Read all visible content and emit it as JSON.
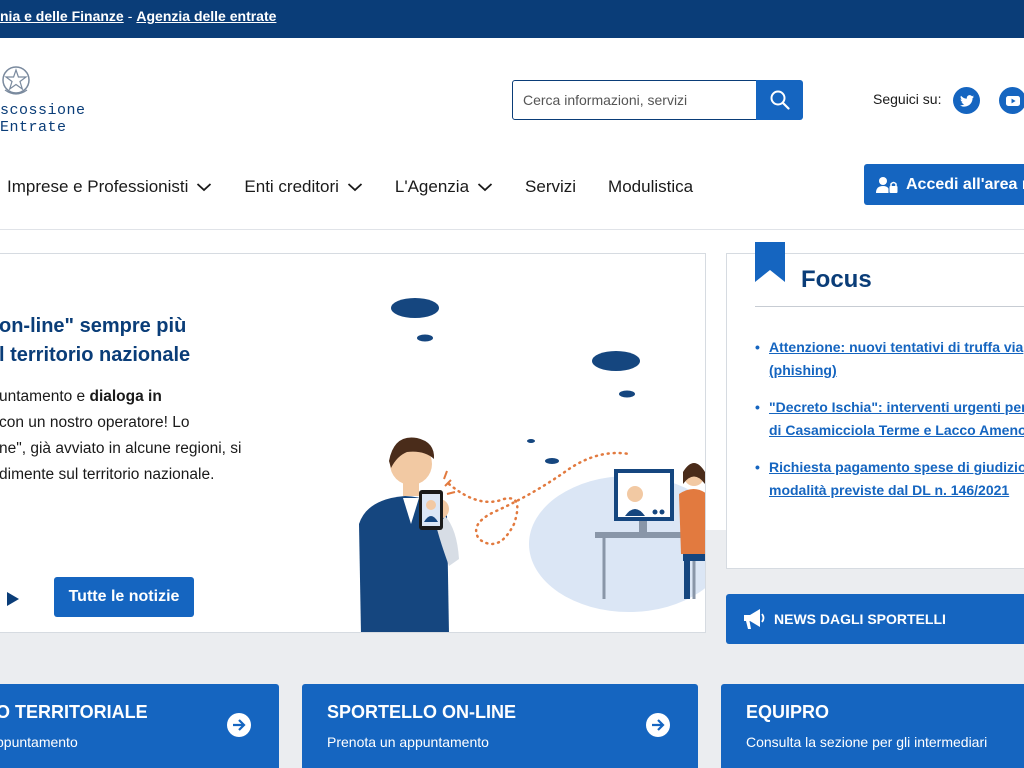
{
  "topbar": {
    "link1": "nia e delle Finanze",
    "separator": "-",
    "link2": "Agenzia delle entrate"
  },
  "logo": {
    "line1": "scossione",
    "line2": "Entrate"
  },
  "search": {
    "placeholder": "Cerca informazioni, servizi",
    "icon": "search-icon"
  },
  "social": {
    "label": "Seguici su:",
    "icons": [
      "twitter-icon",
      "youtube-icon"
    ]
  },
  "nav": {
    "items": [
      "Imprese e Professionisti",
      "Enti creditori",
      "L'Agenzia",
      "Servizi",
      "Modulistica"
    ],
    "login": "Accedi all'area r"
  },
  "hero": {
    "title_line1": "on-line\" sempre più",
    "title_line2": "l territorio nazionale",
    "text_line1_a": "untamento e ",
    "text_line1_b": "dialoga in",
    "text_line2": "con un nostro operatore! Lo",
    "text_line3": "ne\", già avviato in alcune regioni, si",
    "text_line4": "dimente sul territorio nazionale.",
    "news_button": "Tutte le notizie"
  },
  "focus": {
    "title": "Focus",
    "items": [
      {
        "line1": "Attenzione: nuovi tentativi di truffa via",
        "line2": "(phishing)"
      },
      {
        "line1": "\"Decreto Ischia\": interventi urgenti per",
        "line2": "di Casamicciola Terme e Lacco Ameno"
      },
      {
        "line1": "Richiesta pagamento spese di giudizio",
        "line2": "modalità previste dal DL n. 146/2021"
      }
    ]
  },
  "sportelli": {
    "label": "NEWS DAGLI SPORTELLI"
  },
  "cards": [
    {
      "title": "O TERRITORIALE",
      "sub": "ppuntamento"
    },
    {
      "title": "SPORTELLO ON-LINE",
      "sub": "Prenota un appuntamento"
    },
    {
      "title": "EQUIPRO",
      "sub": "Consulta la sezione per gli intermediari"
    }
  ],
  "colors": {
    "topbar": "#0a3d78",
    "primary": "#1565c0",
    "heading": "#0a3d78"
  }
}
